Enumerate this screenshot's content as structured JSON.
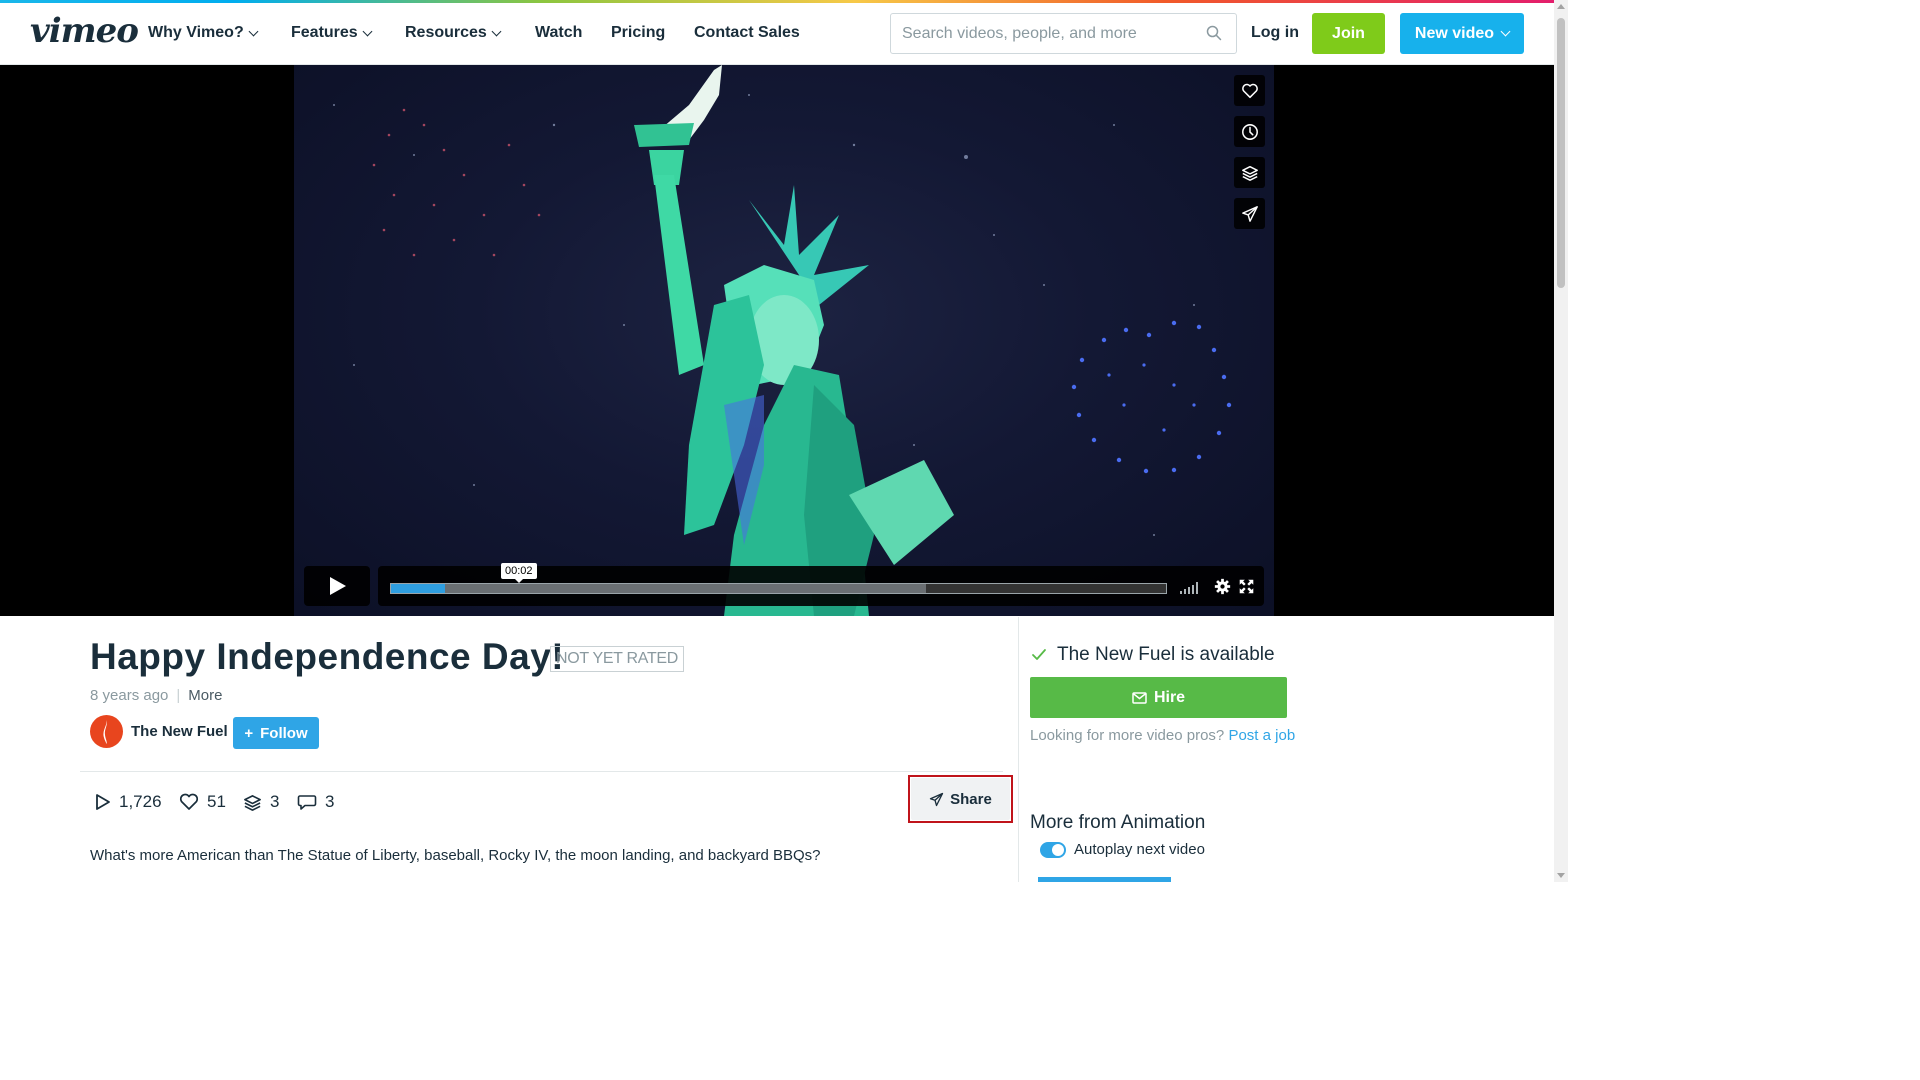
{
  "colors": {
    "join": "#7fcb1a",
    "new_video": "#17b1ec",
    "follow": "#2fa5e6",
    "hire": "#57ba47",
    "progress": "#2f9ee0",
    "share_highlight": "#c0141b"
  },
  "header": {
    "logo": "vimeo",
    "nav": [
      {
        "label": "Why Vimeo?",
        "dropdown": true
      },
      {
        "label": "Features",
        "dropdown": true
      },
      {
        "label": "Resources",
        "dropdown": true
      },
      {
        "label": "Watch",
        "dropdown": false
      },
      {
        "label": "Pricing",
        "dropdown": false
      },
      {
        "label": "Contact Sales",
        "dropdown": false
      }
    ],
    "search_placeholder": "Search videos, people, and more",
    "login_label": "Log in",
    "join_label": "Join",
    "new_video_label": "New video"
  },
  "player": {
    "side_controls": [
      "heart-icon",
      "clock-icon",
      "layers-icon",
      "send-icon"
    ],
    "current_time": "00:02",
    "played_fraction": 0.07,
    "loaded_fraction": 0.69
  },
  "video": {
    "title": "Happy Independence Day!",
    "rating": "NOT YET RATED",
    "age": "8 years ago",
    "more_label": "More",
    "owner": "The New Fuel",
    "follow_label": "Follow",
    "stats": {
      "plays": "1,726",
      "likes": "51",
      "collections": "3",
      "comments": "3"
    },
    "share_label": "Share",
    "description": "What's more American than The Statue of Liberty, baseball, Rocky IV, the moon landing, and backyard BBQs?"
  },
  "sidebar": {
    "availability": "The New Fuel is available",
    "hire_label": "Hire",
    "looking_text": "Looking for more video pros?",
    "post_job_label": "Post a job",
    "more_from": "More from Animation",
    "autoplay_label": "Autoplay next video"
  }
}
